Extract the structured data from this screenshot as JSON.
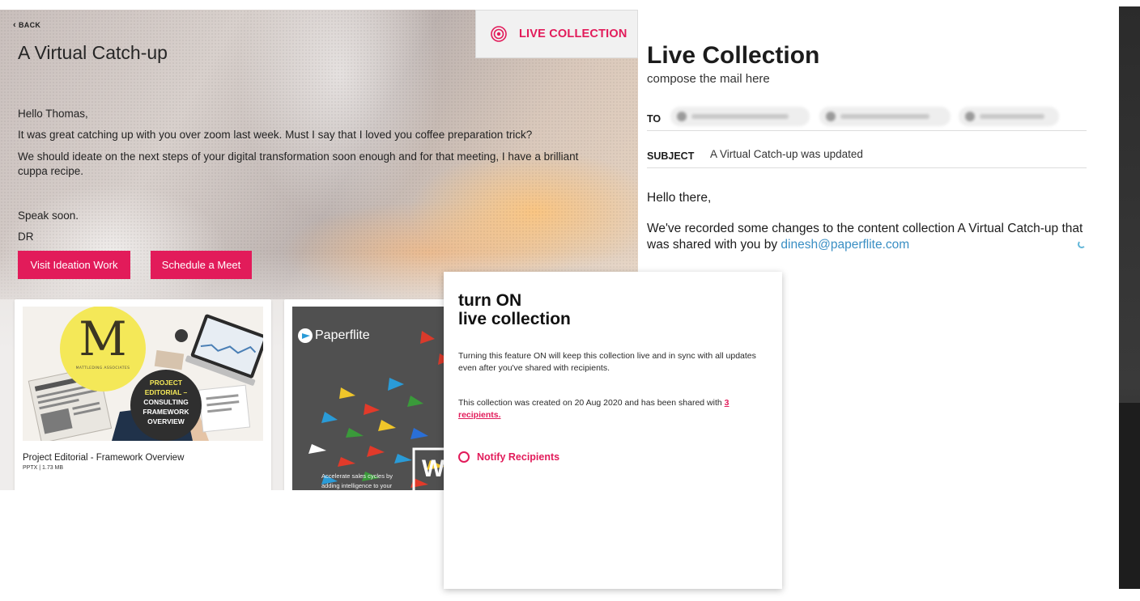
{
  "collection": {
    "back_label": "BACK",
    "title": "A Virtual Catch-up",
    "message": {
      "greeting": "Hello Thomas,",
      "line1": "It was great catching up with you over zoom last week. Must I say that I loved you coffee preparation trick?",
      "line2": "We should ideate on the next steps of your digital transformation soon enough and for that meeting, I have a brilliant cuppa recipe.",
      "closing": "Speak soon.",
      "signature": "DR"
    },
    "buttons": {
      "visit": "Visit Ideation Work",
      "schedule": "Schedule a Meet"
    },
    "cards": [
      {
        "name": "Project Editorial - Framework Overview",
        "meta": "PPTX | 1.73 MB",
        "thumb_logo_letter": "M",
        "thumb_logo_caption": "MATTLEDING ASSOCIATES",
        "thumb_badge": [
          "PROJECT",
          "EDITORIAL –",
          "CONSULTING",
          "FRAMEWORK",
          "OVERVIEW"
        ]
      },
      {
        "brand": "Paperflite",
        "tagline_line1": "Accelerate sales cycles by",
        "tagline_line2": "adding intelligence to your",
        "big_letter": "W"
      }
    ],
    "live_toggle_label": "LIVE COLLECTION"
  },
  "compose": {
    "title": "Live Collection",
    "subtitle": "compose the mail here",
    "to_label": "TO",
    "subject_label": "SUBJECT",
    "subject_value": "A Virtual Catch-up was updated",
    "greeting": "Hello there,",
    "body_prefix": "We've recorded some changes to the content collection A Virtual Catch-up that was shared with you by ",
    "body_link": "dinesh@paperflite.com"
  },
  "modal": {
    "title_line1": "turn ON",
    "title_line2": "live collection",
    "description": "Turning this feature ON will keep this collection live and in sync with all updates even after you've shared with recipients.",
    "created_prefix": "This collection was created on 20 Aug 2020 and has been shared with ",
    "recipients_link": "3 recipients.",
    "notify_label": "Notify Recipients"
  },
  "colors": {
    "accent": "#e21b5a",
    "link": "#3a8fc4"
  },
  "icons": {
    "back": "chevron-left-icon",
    "live": "live-broadcast-icon",
    "paperflite": "paperflite-logo-icon",
    "radio": "radio-unchecked-icon",
    "spinner": "loading-spinner-icon"
  }
}
